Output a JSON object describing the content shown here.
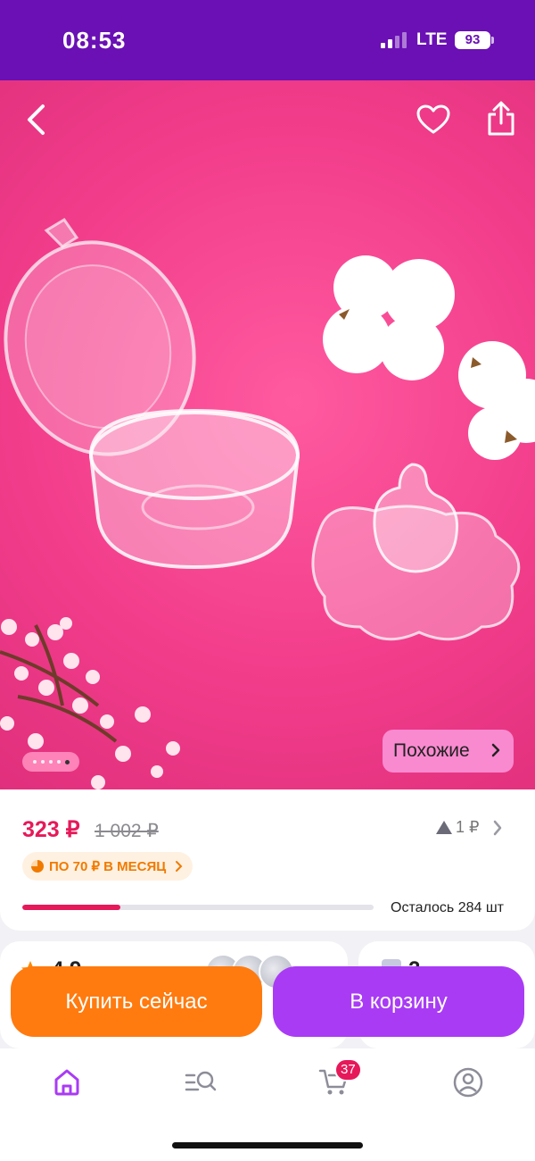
{
  "status_bar": {
    "time": "08:53",
    "network": "LTE",
    "battery": "93"
  },
  "header": {
    "back_icon": "chevron-left-icon",
    "favorite_icon": "heart-icon",
    "share_icon": "share-icon"
  },
  "gallery": {
    "similar_label": "Похожие",
    "dots_total": 5,
    "dots_active_index": 4
  },
  "product": {
    "price": "323 ₽",
    "old_price": "1 002 ₽",
    "rank_label": "1 ₽",
    "installment_label": "ПО 70 ₽ В МЕСЯЦ",
    "stock_fraction": 0.28,
    "stock_text": "Осталось 284 шт"
  },
  "lower_cards": {
    "rating": "4.9",
    "questions": "2"
  },
  "actions": {
    "buy_now": "Купить сейчас",
    "add_to_cart": "В корзину"
  },
  "tabbar": {
    "items": [
      "home-icon",
      "catalog-search-icon",
      "cart-icon",
      "profile-icon"
    ],
    "cart_badge": "37"
  },
  "colors": {
    "status_bar": "#6a10b4",
    "price": "#e6195a",
    "buy_now": "#ff7b0f",
    "add_to_cart": "#a93bf5",
    "active_tab": "#a93bf5"
  }
}
